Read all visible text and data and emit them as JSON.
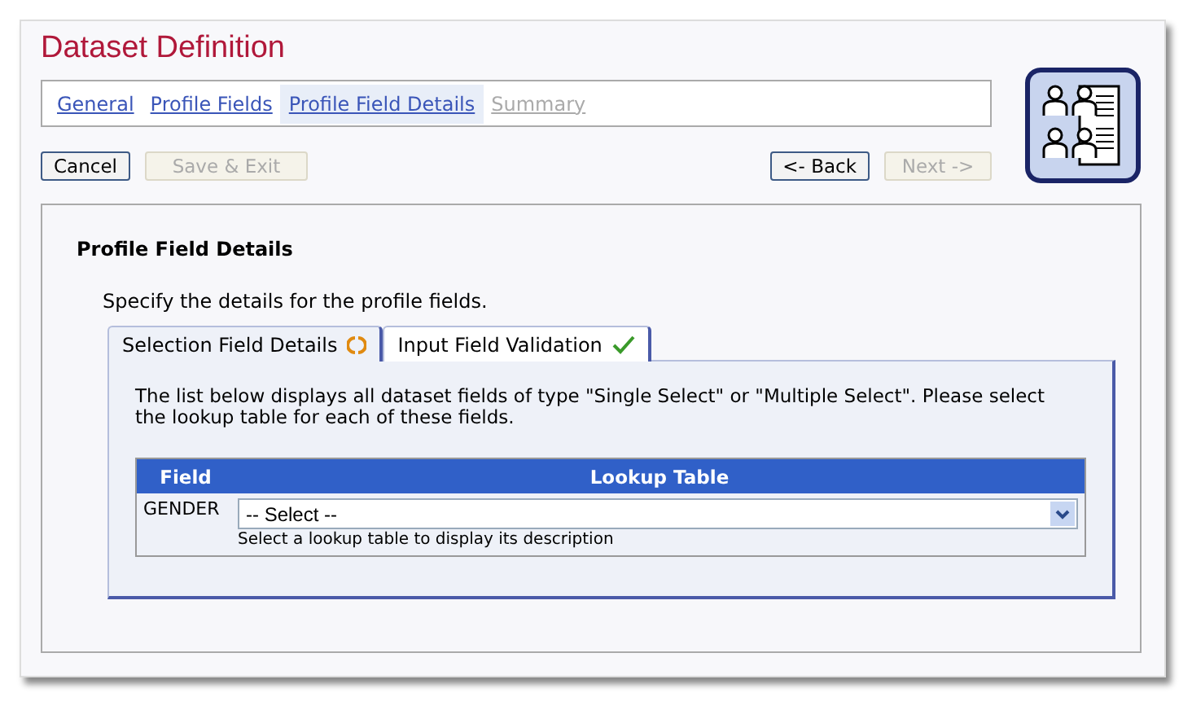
{
  "title": "Dataset Definition",
  "steps": [
    {
      "label": "General",
      "selected": false,
      "disabled": false
    },
    {
      "label": "Profile Fields",
      "selected": false,
      "disabled": false
    },
    {
      "label": "Profile Field Details",
      "selected": true,
      "disabled": false
    },
    {
      "label": "Summary",
      "selected": false,
      "disabled": true
    }
  ],
  "left_buttons": [
    {
      "label": "Cancel",
      "disabled": false
    },
    {
      "label": "Save & Exit",
      "disabled": true
    }
  ],
  "right_buttons": [
    {
      "label": "<- Back",
      "disabled": false
    },
    {
      "label": "Next ->",
      "disabled": true
    }
  ],
  "section": {
    "heading": "Profile Field Details",
    "description": "Specify the details for the profile fields."
  },
  "tabs": [
    {
      "label": "Selection Field Details",
      "selected": true,
      "kind": "pending"
    },
    {
      "label": "Input Field Validation",
      "selected": false,
      "kind": "done"
    }
  ],
  "tab_text": "The list below displays all dataset fields of type \"Single Select\" or \"Multiple Select\". Please select the lookup table for each of these fields.",
  "table": {
    "columns": [
      "Field",
      "Lookup Table"
    ],
    "rows": [
      {
        "field": "GENDER",
        "value": "-- Select --",
        "hint": "Select a lookup table to display its description"
      }
    ]
  }
}
